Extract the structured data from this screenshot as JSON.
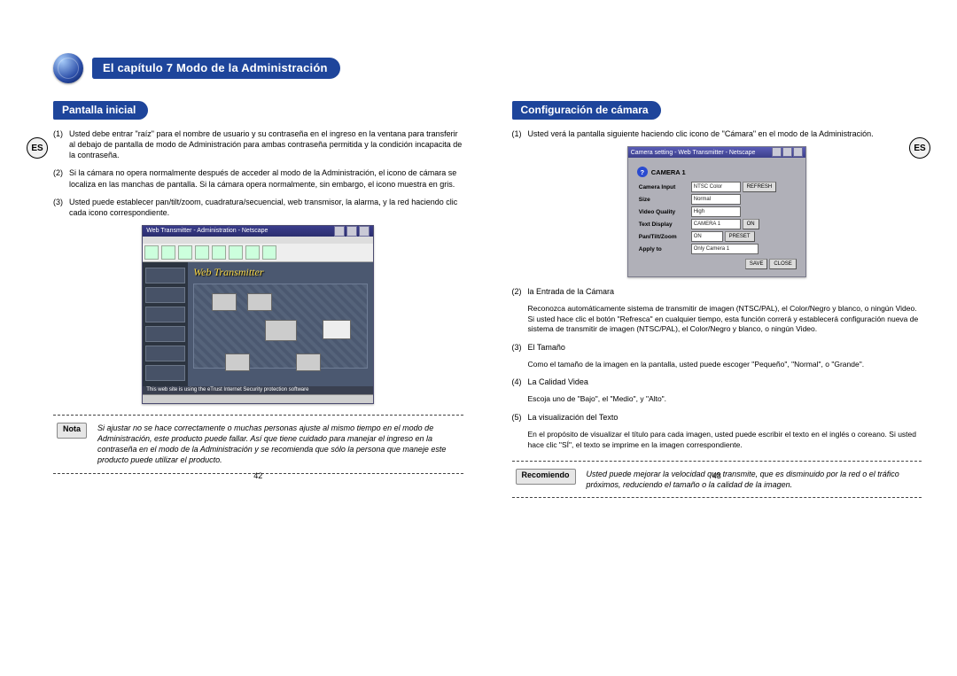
{
  "chapter": {
    "title": "El capítulo 7 Modo de la Administración"
  },
  "lang_badge": "ES",
  "left": {
    "section_title": "Pantalla inicial",
    "items": [
      {
        "num": "(1)",
        "text": "Usted debe entrar \"raíz\" para el nombre de usuario y su contraseña en el ingreso en la ventana para transferir al debajo de pantalla de modo de Administración para ambas contraseña permitida y la condición incapacita de la contraseña."
      },
      {
        "num": "(2)",
        "text": "Si la cámara no opera normalmente después de acceder al modo de la Administración, el icono de cámara se localiza en las manchas de pantalla. Si la cámara opera normalmente, sin embargo, el icono muestra en gris."
      },
      {
        "num": "(3)",
        "text": "Usted puede establecer pan/tilt/zoom, cuadratura/secuencial, web transmisor, la alarma, y la red haciendo clic cada icono correspondiente."
      }
    ],
    "screenshot": {
      "title": "Web Transmitter - Administration - Netscape",
      "banner": "Web Transmitter",
      "status": "This web site is using the eTrust Internet Security protection software"
    },
    "note_label": "Nota",
    "note_text": "Si ajustar no se hace correctamente o muchas personas ajuste al mismo tiempo en el modo de Administración, este producto puede fallar. Así que tiene cuidado para manejar el ingreso en la contraseña en el modo de la Administración y se recomienda que sólo la persona que maneje este producto puede utilizar el producto.",
    "page_num": "42"
  },
  "right": {
    "section_title": "Configuración de cámara",
    "intro_num": "(1)",
    "intro_text": "Usted verá la pantalla siguiente haciendo clic icono de \"Cámara\" en el modo de la Administración.",
    "screenshot": {
      "title": "Camera setting - Web Transmitter - Netscape",
      "cam_heading": "CAMERA 1",
      "rows": {
        "camera_input_label": "Camera Input",
        "camera_input_value": "NTSC Color",
        "refresh_btn": "REFRESH",
        "size_label": "Size",
        "size_value": "Normal",
        "video_quality_label": "Video Quality",
        "video_quality_value": "High",
        "text_display_label": "Text Display",
        "text_display_value": "CAMERA 1",
        "text_on_btn": "ON",
        "ptz_label": "Pan/Tilt/Zoom",
        "ptz_value": "ON",
        "preset_btn": "PRESET",
        "apply_label": "Apply to",
        "apply_value": "Only Camera 1"
      },
      "save_btn": "SAVE",
      "close_btn": "CLOSE"
    },
    "items": [
      {
        "num": "(2)",
        "title": "la Entrada de la Cámara",
        "text": "Reconozca automáticamente sistema de transmitir de imagen (NTSC/PAL), el Color/Negro y blanco, o ningún Video. Si usted hace clic el botón \"Refresca\" en cualquier tiempo, esta función correrá y establecerá configuración nueva de sistema de transmitir de imagen (NTSC/PAL), el Color/Negro y blanco, o ningún Video."
      },
      {
        "num": "(3)",
        "title": "El Tamaño",
        "text": "Como el tamaño de la imagen en la pantalla, usted puede escoger \"Pequeño\", \"Normal\", o \"Grande\"."
      },
      {
        "num": "(4)",
        "title": "La Calidad Videa",
        "text": "Escoja uno de \"Bajo\", el \"Medio\", y \"Alto\"."
      },
      {
        "num": "(5)",
        "title": "La visualización del Texto",
        "text": "En el propósito de visualizar el título para cada imagen, usted puede escribir el texto en el inglés o coreano. Si usted hace clic \"SÍ\", el texto se imprime en la imagen correspondiente."
      }
    ],
    "reco_label": "Recomiendo",
    "reco_text": "Usted puede mejorar la velocidad que transmite, que es disminuido por la red o el tráfico próximos, reduciendo el tamaño o la calidad de la imagen.",
    "page_num": "43"
  }
}
